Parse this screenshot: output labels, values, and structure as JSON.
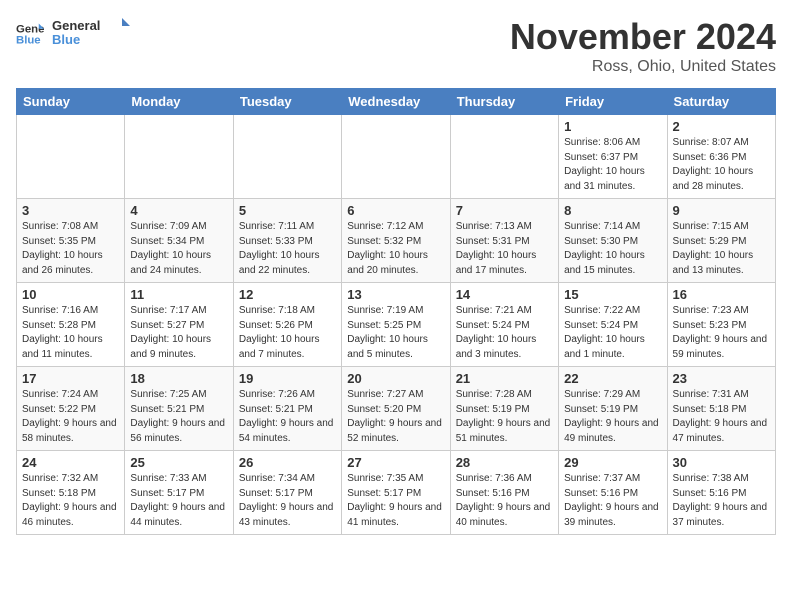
{
  "header": {
    "logo_line1": "General",
    "logo_line2": "Blue",
    "title": "November 2024",
    "location": "Ross, Ohio, United States"
  },
  "weekdays": [
    "Sunday",
    "Monday",
    "Tuesday",
    "Wednesday",
    "Thursday",
    "Friday",
    "Saturday"
  ],
  "weeks": [
    [
      {
        "day": "",
        "info": ""
      },
      {
        "day": "",
        "info": ""
      },
      {
        "day": "",
        "info": ""
      },
      {
        "day": "",
        "info": ""
      },
      {
        "day": "",
        "info": ""
      },
      {
        "day": "1",
        "info": "Sunrise: 8:06 AM\nSunset: 6:37 PM\nDaylight: 10 hours and 31 minutes."
      },
      {
        "day": "2",
        "info": "Sunrise: 8:07 AM\nSunset: 6:36 PM\nDaylight: 10 hours and 28 minutes."
      }
    ],
    [
      {
        "day": "3",
        "info": "Sunrise: 7:08 AM\nSunset: 5:35 PM\nDaylight: 10 hours and 26 minutes."
      },
      {
        "day": "4",
        "info": "Sunrise: 7:09 AM\nSunset: 5:34 PM\nDaylight: 10 hours and 24 minutes."
      },
      {
        "day": "5",
        "info": "Sunrise: 7:11 AM\nSunset: 5:33 PM\nDaylight: 10 hours and 22 minutes."
      },
      {
        "day": "6",
        "info": "Sunrise: 7:12 AM\nSunset: 5:32 PM\nDaylight: 10 hours and 20 minutes."
      },
      {
        "day": "7",
        "info": "Sunrise: 7:13 AM\nSunset: 5:31 PM\nDaylight: 10 hours and 17 minutes."
      },
      {
        "day": "8",
        "info": "Sunrise: 7:14 AM\nSunset: 5:30 PM\nDaylight: 10 hours and 15 minutes."
      },
      {
        "day": "9",
        "info": "Sunrise: 7:15 AM\nSunset: 5:29 PM\nDaylight: 10 hours and 13 minutes."
      }
    ],
    [
      {
        "day": "10",
        "info": "Sunrise: 7:16 AM\nSunset: 5:28 PM\nDaylight: 10 hours and 11 minutes."
      },
      {
        "day": "11",
        "info": "Sunrise: 7:17 AM\nSunset: 5:27 PM\nDaylight: 10 hours and 9 minutes."
      },
      {
        "day": "12",
        "info": "Sunrise: 7:18 AM\nSunset: 5:26 PM\nDaylight: 10 hours and 7 minutes."
      },
      {
        "day": "13",
        "info": "Sunrise: 7:19 AM\nSunset: 5:25 PM\nDaylight: 10 hours and 5 minutes."
      },
      {
        "day": "14",
        "info": "Sunrise: 7:21 AM\nSunset: 5:24 PM\nDaylight: 10 hours and 3 minutes."
      },
      {
        "day": "15",
        "info": "Sunrise: 7:22 AM\nSunset: 5:24 PM\nDaylight: 10 hours and 1 minute."
      },
      {
        "day": "16",
        "info": "Sunrise: 7:23 AM\nSunset: 5:23 PM\nDaylight: 9 hours and 59 minutes."
      }
    ],
    [
      {
        "day": "17",
        "info": "Sunrise: 7:24 AM\nSunset: 5:22 PM\nDaylight: 9 hours and 58 minutes."
      },
      {
        "day": "18",
        "info": "Sunrise: 7:25 AM\nSunset: 5:21 PM\nDaylight: 9 hours and 56 minutes."
      },
      {
        "day": "19",
        "info": "Sunrise: 7:26 AM\nSunset: 5:21 PM\nDaylight: 9 hours and 54 minutes."
      },
      {
        "day": "20",
        "info": "Sunrise: 7:27 AM\nSunset: 5:20 PM\nDaylight: 9 hours and 52 minutes."
      },
      {
        "day": "21",
        "info": "Sunrise: 7:28 AM\nSunset: 5:19 PM\nDaylight: 9 hours and 51 minutes."
      },
      {
        "day": "22",
        "info": "Sunrise: 7:29 AM\nSunset: 5:19 PM\nDaylight: 9 hours and 49 minutes."
      },
      {
        "day": "23",
        "info": "Sunrise: 7:31 AM\nSunset: 5:18 PM\nDaylight: 9 hours and 47 minutes."
      }
    ],
    [
      {
        "day": "24",
        "info": "Sunrise: 7:32 AM\nSunset: 5:18 PM\nDaylight: 9 hours and 46 minutes."
      },
      {
        "day": "25",
        "info": "Sunrise: 7:33 AM\nSunset: 5:17 PM\nDaylight: 9 hours and 44 minutes."
      },
      {
        "day": "26",
        "info": "Sunrise: 7:34 AM\nSunset: 5:17 PM\nDaylight: 9 hours and 43 minutes."
      },
      {
        "day": "27",
        "info": "Sunrise: 7:35 AM\nSunset: 5:17 PM\nDaylight: 9 hours and 41 minutes."
      },
      {
        "day": "28",
        "info": "Sunrise: 7:36 AM\nSunset: 5:16 PM\nDaylight: 9 hours and 40 minutes."
      },
      {
        "day": "29",
        "info": "Sunrise: 7:37 AM\nSunset: 5:16 PM\nDaylight: 9 hours and 39 minutes."
      },
      {
        "day": "30",
        "info": "Sunrise: 7:38 AM\nSunset: 5:16 PM\nDaylight: 9 hours and 37 minutes."
      }
    ]
  ]
}
